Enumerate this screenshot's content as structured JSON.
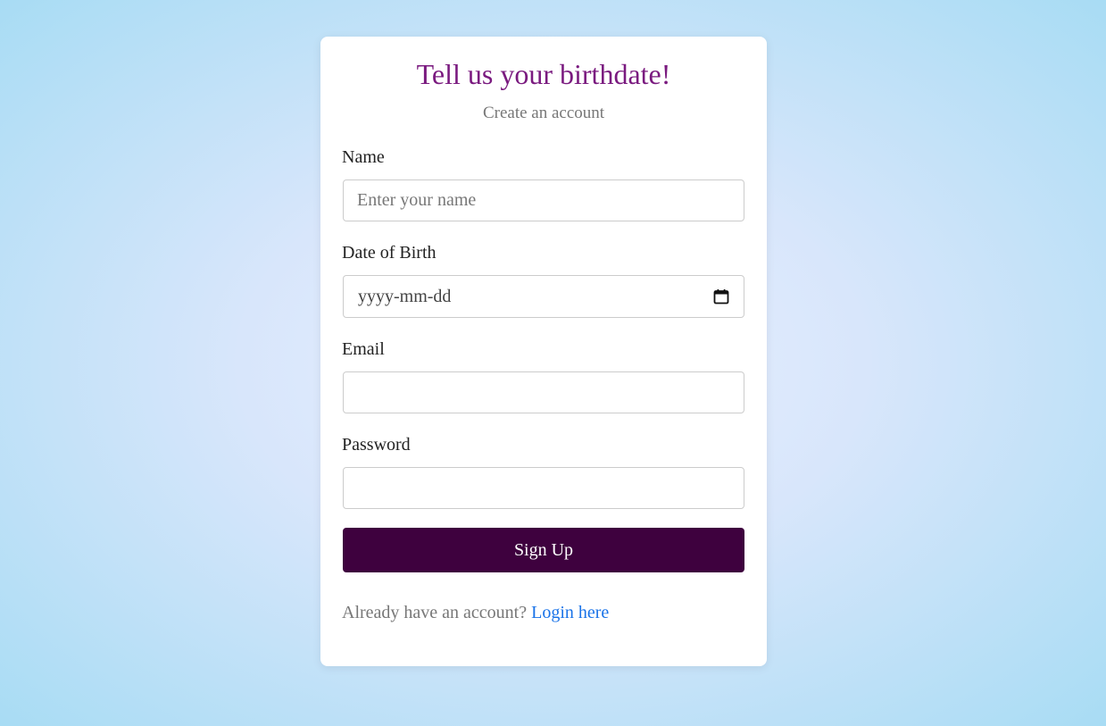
{
  "header": {
    "title": "Tell us your birthdate!",
    "subtitle": "Create an account"
  },
  "form": {
    "name": {
      "label": "Name",
      "placeholder": "Enter your name",
      "value": ""
    },
    "dob": {
      "label": "Date of Birth",
      "placeholder": "yyyy-mm-dd",
      "icon": "calendar-icon"
    },
    "email": {
      "label": "Email",
      "value": ""
    },
    "password": {
      "label": "Password",
      "value": ""
    },
    "submit_label": "Sign Up"
  },
  "footer": {
    "prompt": "Already have an account?",
    "link_label": "Login here"
  },
  "colors": {
    "title": "#7a1a7f",
    "button": "#3e013e",
    "link": "#1a73e8"
  }
}
